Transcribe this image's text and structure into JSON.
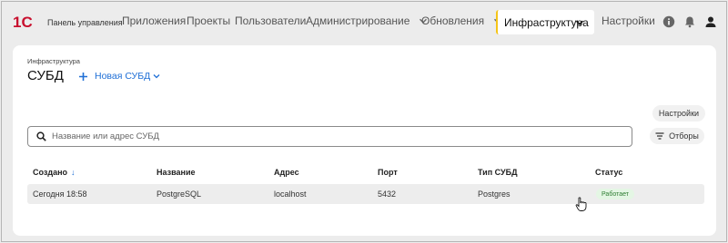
{
  "brand": {
    "logo_text": "1С",
    "label": "Панель управления"
  },
  "nav": {
    "items": [
      {
        "label": "Приложения"
      },
      {
        "label": "Проекты"
      },
      {
        "label": "Пользователи"
      },
      {
        "label": "Администрирование",
        "has_dropdown": true
      },
      {
        "label": "Обновления",
        "has_dropdown": true
      },
      {
        "label": "Инфраструктура",
        "has_dropdown": true,
        "active": true
      },
      {
        "label": "Настройки"
      }
    ],
    "icons": [
      "info-icon",
      "bell-icon",
      "user-icon"
    ]
  },
  "page": {
    "breadcrumb": "Инфраструктура",
    "title": "СУБД",
    "new_button": "Новая СУБД",
    "settings_button": "Настройки",
    "filter_button": "Отборы",
    "search_placeholder": "Название или адрес СУБД"
  },
  "table": {
    "columns": [
      "Создано",
      "Название",
      "Адрес",
      "Порт",
      "Тип СУБД",
      "Статус"
    ],
    "sort_column": "Создано",
    "sort_indicator": "↓",
    "rows": [
      {
        "created": "Сегодня 18:58",
        "name": "PostgreSQL",
        "address": "localhost",
        "port": "5432",
        "type": "Postgres",
        "status": "Работает"
      }
    ]
  },
  "colors": {
    "accent": "#1f6fd6",
    "active_marker": "#f5c518",
    "status_ok_bg": "#e4f6e4",
    "status_ok_text": "#2e7d32",
    "logo": "#c8102e"
  }
}
